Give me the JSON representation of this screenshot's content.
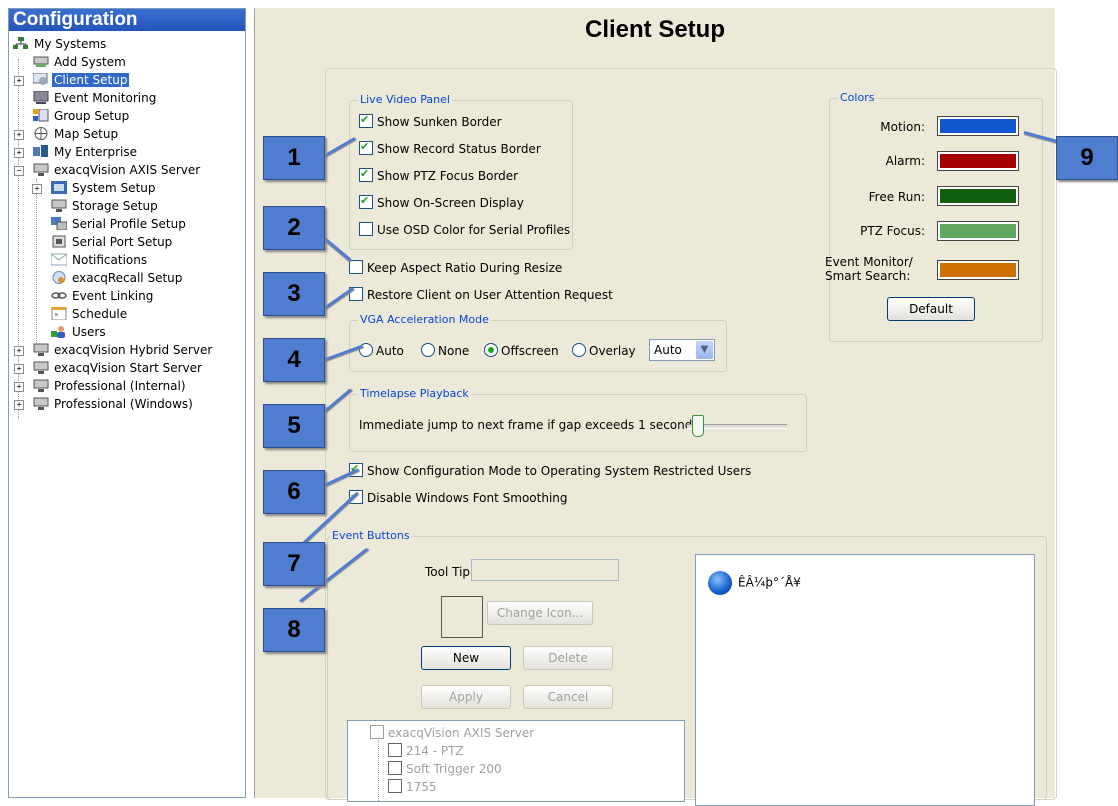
{
  "left_panel": {
    "header": "Configuration",
    "tree": [
      {
        "label": "My Systems",
        "icon": "network-icon"
      },
      {
        "label": "Add System",
        "icon": "add-system-icon"
      },
      {
        "label": "Client Setup",
        "icon": "client-setup-icon",
        "selected": true
      },
      {
        "label": "Event Monitoring",
        "icon": "monitor-icon"
      },
      {
        "label": "Group Setup",
        "icon": "group-icon"
      },
      {
        "label": "Map Setup",
        "icon": "map-icon"
      },
      {
        "label": "My Enterprise",
        "icon": "enterprise-icon"
      },
      {
        "label": "exacqVision AXIS Server",
        "icon": "server-icon"
      },
      {
        "label": "System Setup",
        "icon": "system-icon"
      },
      {
        "label": "Storage Setup",
        "icon": "storage-icon"
      },
      {
        "label": "Serial Profile Setup",
        "icon": "serial-profile-icon"
      },
      {
        "label": "Serial Port Setup",
        "icon": "serial-port-icon"
      },
      {
        "label": "Notifications",
        "icon": "mail-icon"
      },
      {
        "label": "exacqRecall Setup",
        "icon": "recall-icon"
      },
      {
        "label": "Event Linking",
        "icon": "link-icon"
      },
      {
        "label": "Schedule",
        "icon": "calendar-icon"
      },
      {
        "label": "Users",
        "icon": "users-icon"
      },
      {
        "label": "exacqVision Hybrid Server",
        "icon": "server-icon"
      },
      {
        "label": "exacqVision Start Server",
        "icon": "server-icon"
      },
      {
        "label": "Professional (Internal)",
        "icon": "server-icon"
      },
      {
        "label": "Professional (Windows)",
        "icon": "server-icon"
      }
    ]
  },
  "main": {
    "title": "Client Setup",
    "live_video": {
      "legend": "Live Video Panel",
      "options": [
        {
          "label": "Show Sunken Border",
          "checked": true
        },
        {
          "label": "Show Record Status Border",
          "checked": true
        },
        {
          "label": "Show PTZ Focus Border",
          "checked": true
        },
        {
          "label": "Show On-Screen Display",
          "checked": true
        },
        {
          "label": "Use OSD Color for Serial Profiles",
          "checked": false
        }
      ]
    },
    "keep_aspect": {
      "label": "Keep Aspect Ratio During Resize",
      "checked": false
    },
    "restore_client": {
      "label": "Restore Client on User Attention Request",
      "checked": false
    },
    "vga": {
      "legend": "VGA Acceleration Mode",
      "options": [
        "Auto",
        "None",
        "Offscreen",
        "Overlay"
      ],
      "selected": "Offscreen",
      "dropdown_value": "Auto"
    },
    "timelapse": {
      "legend": "Timelapse Playback",
      "label": "Immediate jump to next frame if gap exceeds 1 second",
      "slider_value": 0.1
    },
    "show_config": {
      "label": "Show Configuration Mode to Operating System Restricted Users",
      "checked": true
    },
    "disable_font": {
      "label": "Disable Windows Font Smoothing",
      "checked": true
    },
    "colors": {
      "legend": "Colors",
      "items": [
        {
          "label": "Motion:",
          "color": "#1257d0"
        },
        {
          "label": "Alarm:",
          "color": "#a80000"
        },
        {
          "label": "Free Run:",
          "color": "#106010"
        },
        {
          "label": "PTZ Focus:",
          "color": "#60a860"
        },
        {
          "label": "Event Monitor/ Smart Search:",
          "color": "#d07000"
        }
      ],
      "default_button": "Default"
    },
    "event_buttons": {
      "legend": "Event Buttons",
      "tooltip_label": "Tool Tip:",
      "tooltip_value": "",
      "change_icon": "Change Icon...",
      "new": "New",
      "delete": "Delete",
      "apply": "Apply",
      "cancel": "Cancel",
      "list_item": "ÊÂ¼þ°´Å¥",
      "tree": [
        {
          "label": "exacqVision AXIS Server"
        },
        {
          "label": "214 - PTZ"
        },
        {
          "label": "Soft Trigger 200"
        },
        {
          "label": "1755"
        }
      ]
    }
  },
  "callouts": [
    "1",
    "2",
    "3",
    "4",
    "5",
    "6",
    "7",
    "8",
    "9"
  ]
}
